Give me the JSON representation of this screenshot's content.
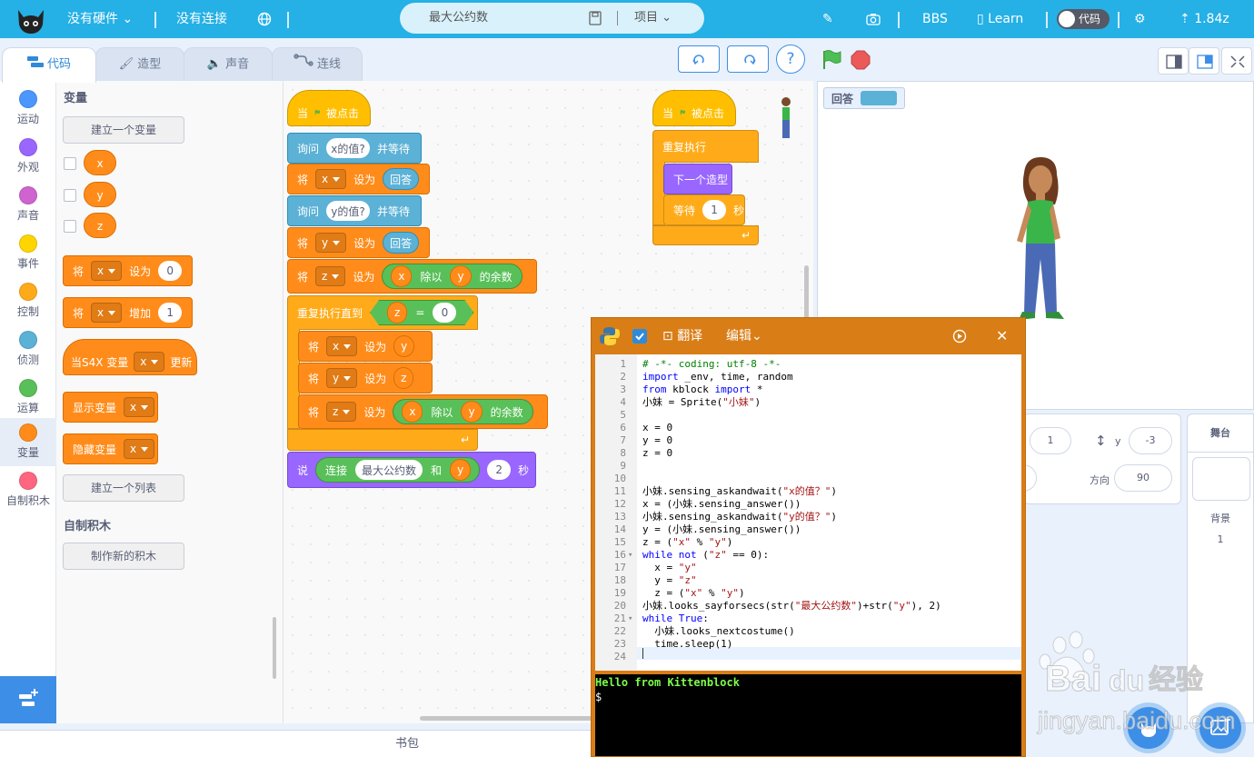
{
  "topbar": {
    "hardware_menu": "没有硬件",
    "connection_menu": "没有连接",
    "project_name": "最大公约数",
    "project_menu": "项目",
    "bbs": "BBS",
    "learn": "Learn",
    "code_toggle": "代码",
    "version": "1.84z"
  },
  "tabs": [
    {
      "label": "代码"
    },
    {
      "label": "造型"
    },
    {
      "label": "声音"
    },
    {
      "label": "连线"
    }
  ],
  "categories": [
    {
      "label": "运动",
      "color": "#4c97ff"
    },
    {
      "label": "外观",
      "color": "#9966ff"
    },
    {
      "label": "声音",
      "color": "#cf63cf"
    },
    {
      "label": "事件",
      "color": "#ffd500"
    },
    {
      "label": "控制",
      "color": "#ffab19"
    },
    {
      "label": "侦测",
      "color": "#5cb1d6"
    },
    {
      "label": "运算",
      "color": "#59c059"
    },
    {
      "label": "变量",
      "color": "#ff8c1a"
    },
    {
      "label": "自制积木",
      "color": "#ff6680"
    }
  ],
  "palette": {
    "var_heading": "变量",
    "make_var": "建立一个变量",
    "variables": [
      "x",
      "y",
      "z"
    ],
    "set_block": {
      "w1": "将",
      "var": "x",
      "w2": "设为",
      "val": "0"
    },
    "change_block": {
      "w1": "将",
      "var": "x",
      "w2": "增加",
      "val": "1"
    },
    "when_s4x": {
      "w1": "当S4X 变量",
      "var": "x",
      "w2": "更新"
    },
    "show_var": {
      "w1": "显示变量",
      "var": "x"
    },
    "hide_var": {
      "w1": "隐藏变量",
      "var": "x"
    },
    "make_list": "建立一个列表",
    "custom_heading": "自制积木",
    "make_block": "制作新的积木"
  },
  "script1": {
    "hat": {
      "w1": "当",
      "w2": "被点击"
    },
    "ask_x": {
      "w1": "询问",
      "q": "x的值?",
      "w2": "并等待"
    },
    "set_x": {
      "w1": "将",
      "var": "x",
      "w2": "设为",
      "rep": "回答"
    },
    "ask_y": {
      "w1": "询问",
      "q": "y的值?",
      "w2": "并等待"
    },
    "set_y": {
      "w1": "将",
      "var": "y",
      "w2": "设为",
      "rep": "回答"
    },
    "set_z": {
      "w1": "将",
      "var": "z",
      "w2": "设为",
      "a": "x",
      "op": "除以",
      "b": "y",
      "w3": "的余数"
    },
    "repeat_until": {
      "w1": "重复执行直到",
      "a": "z",
      "op": "=",
      "b": "0"
    },
    "in_set_x": {
      "w1": "将",
      "var": "x",
      "w2": "设为",
      "rep": "y"
    },
    "in_set_y": {
      "w1": "将",
      "var": "y",
      "w2": "设为",
      "rep": "z"
    },
    "in_set_z": {
      "w1": "将",
      "var": "z",
      "w2": "设为",
      "a": "x",
      "op": "除以",
      "b": "y",
      "w3": "的余数"
    },
    "say": {
      "w1": "说",
      "join": "连接",
      "s1": "最大公约数",
      "and": "和",
      "s2": "y",
      "secs": "2",
      "w2": "秒"
    }
  },
  "script2": {
    "hat": {
      "w1": "当",
      "w2": "被点击"
    },
    "forever": "重复执行",
    "next_costume": "下一个造型",
    "wait": {
      "w1": "等待",
      "val": "1",
      "w2": "秒"
    }
  },
  "stage": {
    "monitor_label": "回答"
  },
  "sprite_info": {
    "x_val": "1",
    "y_label": "y",
    "y_val": "-3",
    "dir_label": "方向",
    "dir_val": "90"
  },
  "stage_col": {
    "heading": "舞台",
    "backdrop_label": "背景",
    "backdrop_count": "1"
  },
  "bottom": {
    "backpack": "书包"
  },
  "code_window": {
    "translate": "翻译",
    "edit": "编辑",
    "lines": [
      "# -*- coding: utf-8 -*-",
      "import _env, time, random",
      "from kblock import *",
      "小妹 = Sprite(\"小妹\")",
      "",
      "x = 0",
      "y = 0",
      "z = 0",
      "",
      "",
      "小妹.sensing_askandwait(\"x的值？\")",
      "x = (小妹.sensing_answer())",
      "小妹.sensing_askandwait(\"y的值？\")",
      "y = (小妹.sensing_answer())",
      "z = (\"x\" % \"y\")",
      "while not (\"z\" == 0):",
      "  x = \"y\"",
      "  y = \"z\"",
      "  z = (\"x\" % \"y\")",
      "小妹.looks_sayforsecs(str(\"最大公约数\")+str(\"y\"), 2)",
      "while True:",
      "  小妹.looks_nextcostume()",
      "  time.sleep(1)",
      ""
    ],
    "line_numbers": [
      "1",
      "2",
      "3",
      "4",
      "5",
      "6",
      "7",
      "8",
      "9",
      "10",
      "11",
      "12",
      "13",
      "14",
      "15",
      "16",
      "17",
      "18",
      "19",
      "20",
      "21",
      "22",
      "23",
      "24"
    ],
    "terminal_line1": "Hello from Kittenblock",
    "terminal_line2": "$"
  },
  "watermark": {
    "text1": "Bai",
    "text2": "du",
    "text3": "经验",
    "text4": "jingyan.baidu.com"
  }
}
